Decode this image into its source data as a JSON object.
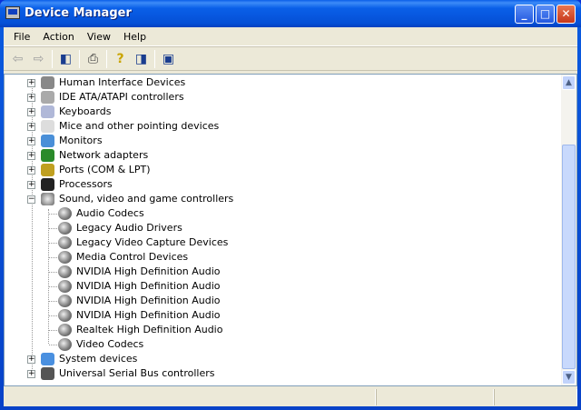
{
  "window": {
    "title": "Device Manager",
    "minimize": "_",
    "maximize": "□",
    "close": "✕"
  },
  "menu": [
    "File",
    "Action",
    "View",
    "Help"
  ],
  "toolbar": {
    "icons": [
      "back-icon",
      "forward-icon",
      "show-hide-console-tree-icon",
      "print-icon",
      "help-icon",
      "show-hide-action-pane-icon",
      "scan-hardware-icon"
    ]
  },
  "tree": {
    "before": [
      "Human Interface Devices",
      "IDE ATA/ATAPI controllers",
      "Keyboards",
      "Mice and other pointing devices",
      "Monitors",
      "Network adapters",
      "Ports (COM & LPT)",
      "Processors"
    ],
    "expanded": "Sound, video and game controllers",
    "children": [
      "Audio Codecs",
      "Legacy Audio Drivers",
      "Legacy Video Capture Devices",
      "Media Control Devices",
      "NVIDIA High Definition Audio",
      "NVIDIA High Definition Audio",
      "NVIDIA High Definition Audio",
      "NVIDIA High Definition Audio",
      "Realtek High Definition Audio",
      "Video Codecs"
    ],
    "after": [
      "System devices",
      "Universal Serial Bus controllers"
    ]
  },
  "colors": {
    "titlebar": "#0a5fe8",
    "chrome": "#ece9d8"
  }
}
